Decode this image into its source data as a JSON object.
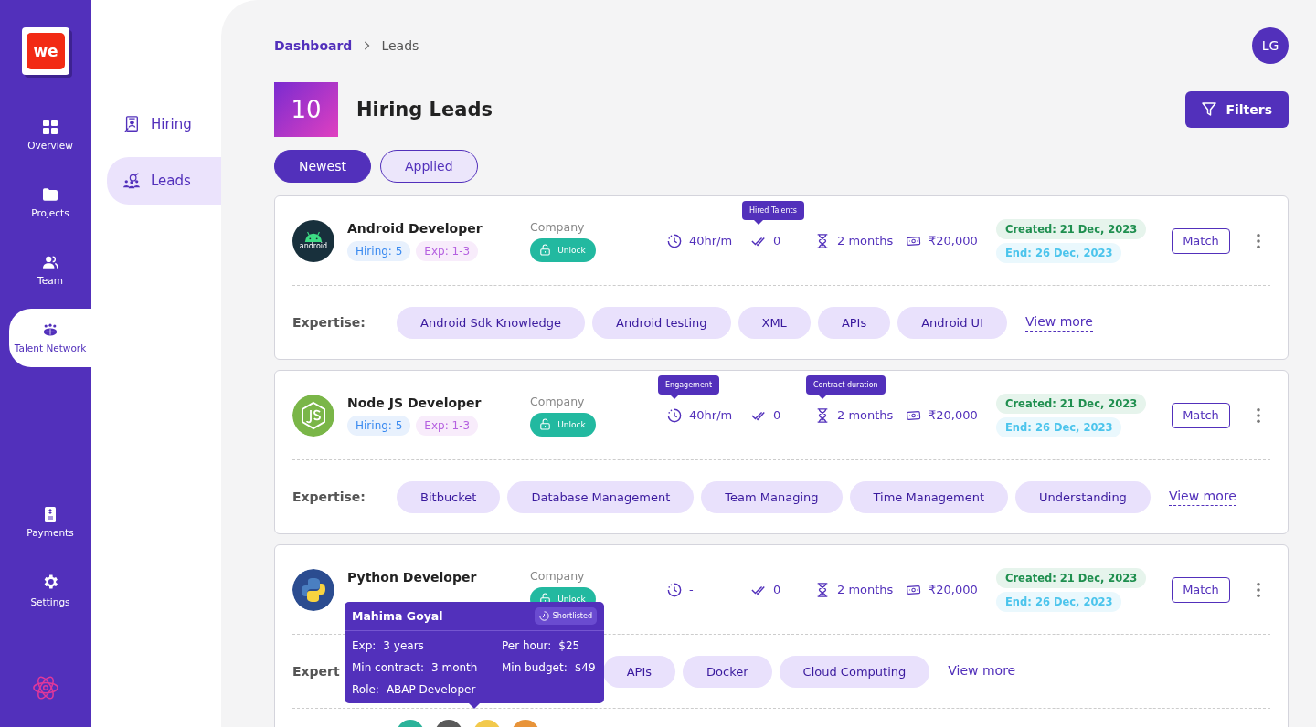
{
  "rail": {
    "logo": "we",
    "items": [
      {
        "label": "Overview",
        "selected": false
      },
      {
        "label": "Projects",
        "selected": false
      },
      {
        "label": "Team",
        "selected": false
      },
      {
        "label": "Talent Network",
        "selected": true
      },
      {
        "label": "Payments",
        "selected": false
      },
      {
        "label": "Settings",
        "selected": false
      }
    ]
  },
  "subnav": [
    {
      "label": "Hiring",
      "selected": false
    },
    {
      "label": "Leads",
      "selected": true
    }
  ],
  "breadcrumb": [
    {
      "label": "Dashboard",
      "kind": "link"
    },
    {
      "label": "Leads",
      "kind": "current"
    }
  ],
  "user": {
    "initials": "LG"
  },
  "header": {
    "count": "10",
    "title": "Hiring Leads",
    "filters": "Filters"
  },
  "tabs": [
    {
      "label": "Newest",
      "selected": true
    },
    {
      "label": "Applied",
      "selected": false
    }
  ],
  "leads": [
    {
      "title": "Android Developer",
      "logo_text": "android",
      "hiring": "Hiring: 5",
      "exp": "Exp: 1-3",
      "company_label": "Company",
      "unlock": "Unlock",
      "stats": [
        {
          "kind": "engagement",
          "value": "40hr/m"
        },
        {
          "kind": "hired",
          "value": "0",
          "tooltip": "Hired Talents"
        },
        {
          "kind": "duration",
          "value": "2 months"
        },
        {
          "kind": "budget",
          "value": "₹20,000"
        }
      ],
      "created": "Created: 21 Dec, 2023",
      "end": "End: 26 Dec, 2023",
      "match": "Match",
      "expertise_label": "Expertise:",
      "expertise": [
        "Android Sdk Knowledge",
        "Android testing",
        "XML",
        "APIs",
        "Android UI"
      ],
      "view_more": "View more"
    },
    {
      "title": "Node JS Developer",
      "hiring": "Hiring: 5",
      "exp": "Exp: 1-3",
      "company_label": "Company",
      "unlock": "Unlock",
      "stats": [
        {
          "kind": "engagement",
          "value": "40hr/m",
          "tooltip": "Engagement"
        },
        {
          "kind": "hired",
          "value": "0"
        },
        {
          "kind": "duration",
          "value": "2 months",
          "tooltip": "Contract duration"
        },
        {
          "kind": "budget",
          "value": "₹20,000"
        }
      ],
      "created": "Created: 21 Dec, 2023",
      "end": "End: 26 Dec, 2023",
      "match": "Match",
      "expertise_label": "Expertise:",
      "expertise": [
        "Bitbucket",
        "Database Management",
        "Team Managing",
        "Time Management",
        "Understanding"
      ],
      "view_more": "View more"
    },
    {
      "title": "Python Developer",
      "company_label": "Company",
      "unlock": "Unlock",
      "stats": [
        {
          "kind": "engagement",
          "value": "-"
        },
        {
          "kind": "hired",
          "value": "0"
        },
        {
          "kind": "duration",
          "value": "2 months"
        },
        {
          "kind": "budget",
          "value": "₹20,000"
        }
      ],
      "created": "Created: 21 Dec, 2023",
      "end": "End: 26 Dec, 2023",
      "match": "Match",
      "expertise_label": "Expert",
      "expertise": [
        "APIs",
        "Docker",
        "Cloud Computing"
      ],
      "view_more": "View more",
      "avatars": [
        {
          "color": "#2bb39a"
        },
        {
          "color": "#5a5a5a"
        },
        {
          "color": "#f2c94c"
        },
        {
          "color": "#e8943a"
        }
      ],
      "popover": {
        "name": "Mahima Goyal",
        "status": "Shortlisted",
        "fields": [
          {
            "label": "Exp:",
            "value": "3 years"
          },
          {
            "label": "Per hour:",
            "value": "$25"
          },
          {
            "label": "Min contract:",
            "value": "3 month"
          },
          {
            "label": "Min budget:",
            "value": "$49"
          },
          {
            "label": "Role:",
            "value": "ABAP Developer"
          }
        ]
      }
    }
  ]
}
